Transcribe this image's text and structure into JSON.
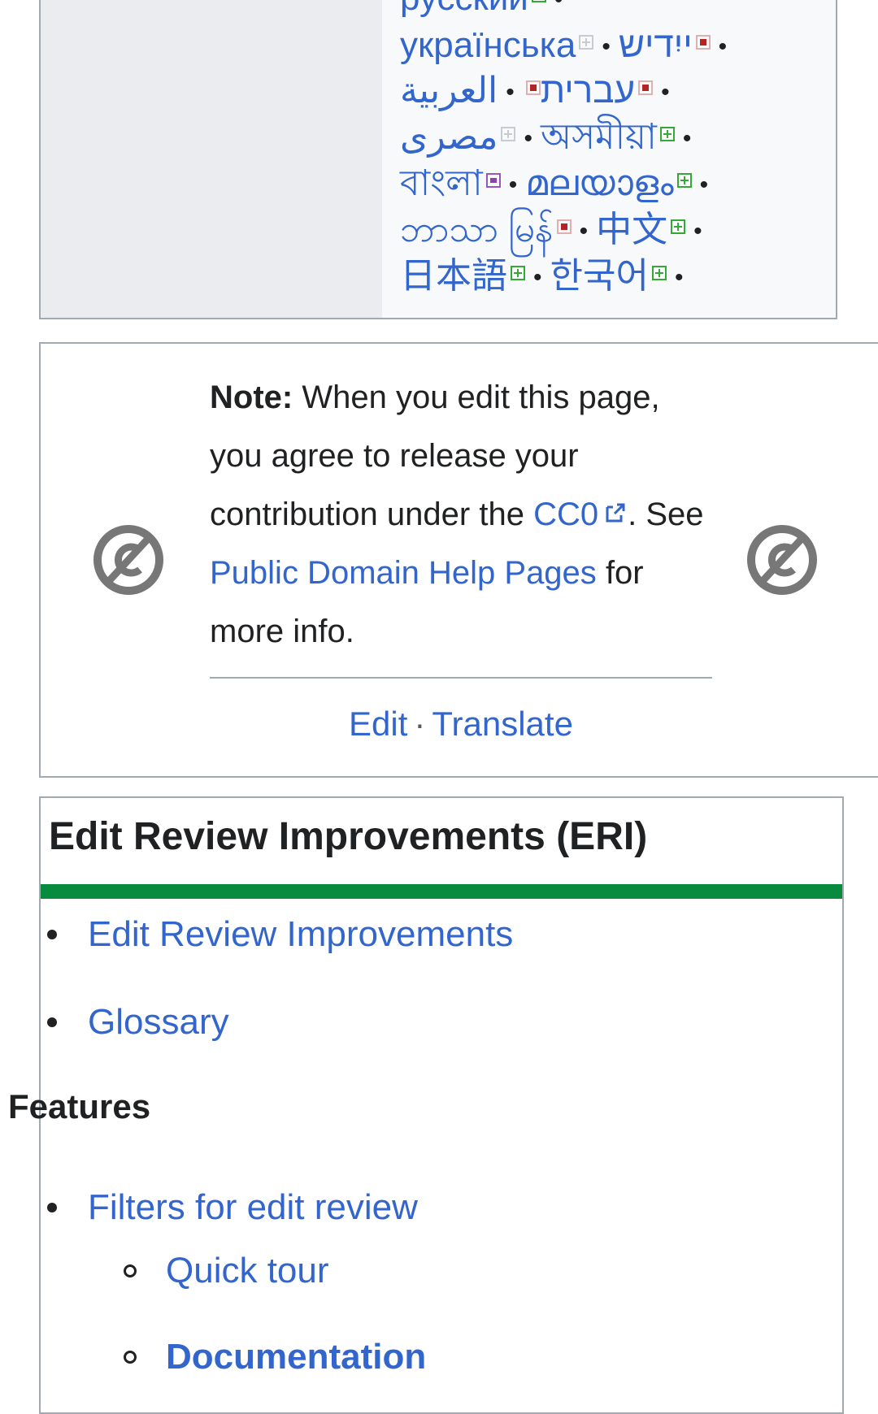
{
  "languages": {
    "lines": [
      [
        {
          "name": "русский",
          "mark": "green"
        }
      ],
      [
        {
          "name": "українська",
          "mark": "grey"
        },
        {
          "name": "ייִדיש",
          "mark": "red"
        }
      ],
      [
        {
          "name": "עברית",
          "mark": "red"
        },
        {
          "name": "العربية",
          "mark": "red"
        }
      ],
      [
        {
          "name": "مصرى",
          "mark": "grey"
        },
        {
          "name": "অসমীয়া",
          "mark": "green"
        }
      ],
      [
        {
          "name": "বাংলা",
          "mark": "purple"
        },
        {
          "name": "മലയാളം",
          "mark": "green"
        }
      ],
      [
        {
          "name": "ဘာသာ မြန်",
          "mark": "red"
        },
        {
          "name": "中文",
          "mark": "green"
        }
      ],
      [
        {
          "name": "日本語",
          "mark": "green"
        },
        {
          "name": "한국어",
          "mark": "green"
        }
      ]
    ]
  },
  "note": {
    "label": "Note:",
    "text_1": "When you edit this page, you agree to release your contribution under the",
    "cc0_link": "CC0",
    "text_2": ". See",
    "help_link": "Public Domain Help Pages",
    "text_3": "for more info.",
    "edit_link": "Edit",
    "separator": "·",
    "translate_link": "Translate"
  },
  "eri": {
    "title": "Edit Review Improvements (ERI)",
    "accent_color": "#088a3f",
    "items": [
      "Edit Review Improvements",
      "Glossary"
    ],
    "features_heading": "Features",
    "features": [
      {
        "label": "Filters for edit review",
        "level": 1,
        "bold": false
      },
      {
        "label": "Quick tour",
        "level": 2,
        "bold": false
      },
      {
        "label": "Documentation",
        "level": 2,
        "bold": true
      }
    ]
  }
}
